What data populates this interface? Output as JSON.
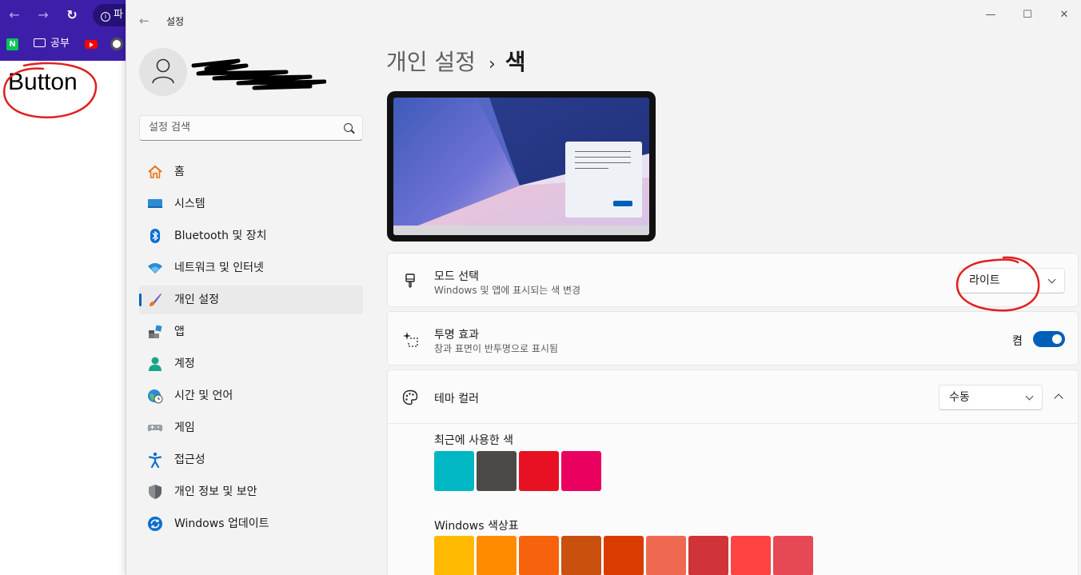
{
  "browser": {
    "back_glyph": "←",
    "forward_glyph": "→",
    "reload_glyph": "↻",
    "omnibox_text": "파",
    "bookmarks": [
      {
        "label": "N",
        "icon": "naver-icon"
      },
      {
        "label": "공부",
        "icon": "folder-icon"
      },
      {
        "label": "",
        "icon": "youtube-icon"
      },
      {
        "label": "",
        "icon": "chatgpt-icon"
      }
    ],
    "page_text": "Button",
    "accent": "#3d1ea8"
  },
  "window": {
    "title": "설정",
    "back_glyph": "←",
    "controls": {
      "minimize": "—",
      "maximize": "☐",
      "close": "✕"
    }
  },
  "sidebar": {
    "search_placeholder": "설정 검색",
    "items": [
      {
        "label": "홈",
        "icon": "home-icon"
      },
      {
        "label": "시스템",
        "icon": "system-icon"
      },
      {
        "label": "Bluetooth 및 장치",
        "icon": "bluetooth-icon"
      },
      {
        "label": "네트워크 및 인터넷",
        "icon": "wifi-icon"
      },
      {
        "label": "개인 설정",
        "icon": "brush-icon",
        "active": true
      },
      {
        "label": "앱",
        "icon": "apps-icon"
      },
      {
        "label": "계정",
        "icon": "account-icon"
      },
      {
        "label": "시간 및 언어",
        "icon": "globe-clock-icon"
      },
      {
        "label": "게임",
        "icon": "gamepad-icon"
      },
      {
        "label": "접근성",
        "icon": "accessibility-icon"
      },
      {
        "label": "개인 정보 및 보안",
        "icon": "shield-icon"
      },
      {
        "label": "Windows 업데이트",
        "icon": "update-icon"
      }
    ]
  },
  "main": {
    "breadcrumb_parent": "개인 설정",
    "breadcrumb_sep": "›",
    "breadcrumb_current": "색",
    "mode": {
      "title": "모드 선택",
      "desc": "Windows 및 앱에 표시되는 색 변경",
      "value": "라이트"
    },
    "transparency": {
      "title": "투명 효과",
      "desc": "창과 표면이 반투명으로 표시됨",
      "state": "켬",
      "on": true
    },
    "theme_color": {
      "title": "테마 컬러",
      "value": "수동"
    },
    "recent_label": "최근에 사용한 색",
    "recent_colors": [
      "#00b7c3",
      "#4c4a48",
      "#e81123",
      "#ea005e"
    ],
    "palette_label": "Windows 색상표",
    "palette_colors": [
      "#ffb900",
      "#ff8c00",
      "#f7630c",
      "#ca5010",
      "#da3b01",
      "#ef6950",
      "#d13438",
      "#ff4343",
      "#e74856"
    ],
    "accent": "#005fb8"
  }
}
